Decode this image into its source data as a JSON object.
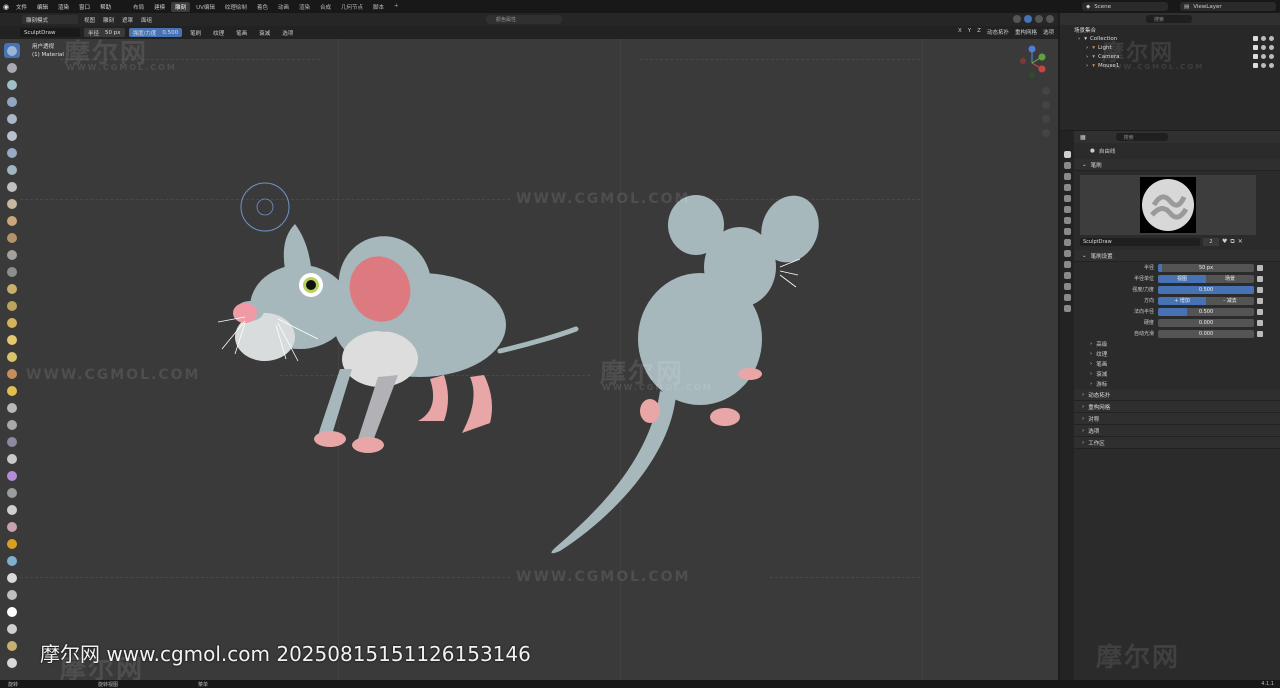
{
  "topbar": {
    "menus": [
      "文件",
      "编辑",
      "渲染",
      "窗口",
      "帮助"
    ],
    "workspaces": [
      {
        "label": "布局",
        "active": false
      },
      {
        "label": "建模",
        "active": false
      },
      {
        "label": "雕刻",
        "active": true
      },
      {
        "label": "UV编辑",
        "active": false
      },
      {
        "label": "纹理绘制",
        "active": false
      },
      {
        "label": "着色",
        "active": false
      },
      {
        "label": "动画",
        "active": false
      },
      {
        "label": "渲染",
        "active": false
      },
      {
        "label": "合成",
        "active": false
      },
      {
        "label": "几何节点",
        "active": false
      },
      {
        "label": "脚本",
        "active": false
      }
    ],
    "plus": "+",
    "scene": "Scene",
    "view_layer": "ViewLayer"
  },
  "viewport_header": {
    "mode": "雕刻模式",
    "menus": [
      "视图",
      "雕刻",
      "遮罩",
      "面组"
    ],
    "center_text": "颜色属性"
  },
  "tool_header": {
    "brush": "SculptDraw",
    "radius_label": "半径",
    "radius_value": "50 px",
    "strength_label": "强度/力度",
    "strength_value": "0.500",
    "dropdowns": [
      "笔刷",
      "纹理",
      "笔画",
      "衰减",
      "选项"
    ],
    "right_items": [
      "X",
      "Y",
      "Z",
      "动态拓扑",
      "重构网格",
      "选项"
    ]
  },
  "viewport": {
    "label_line1": "用户透视",
    "label_line2": "(1) Material",
    "accent": "#4772b3"
  },
  "watermarks": {
    "logo": "摩尔网",
    "url": "WWW.CGMOL.COM"
  },
  "stamp": "摩尔网 www.cgmol.com 20250815151126153146",
  "statusbar": {
    "items": [
      "旋转",
      "旋转视图",
      "菜单"
    ],
    "version": "4.1.1"
  },
  "outliner": {
    "title": "场景集合",
    "search_placeholder": "搜索",
    "rows": [
      {
        "label": "Collection"
      },
      {
        "label": "Light"
      },
      {
        "label": "Camera"
      },
      {
        "label": "Mouse1"
      }
    ]
  },
  "properties": {
    "search_placeholder": "搜索",
    "object_name": "自由线",
    "brush_section": "笔刷",
    "brush_name": "SculptDraw",
    "brush_users": "2",
    "settings_section": "笔刷设置",
    "rows": [
      {
        "label": "半径",
        "value": "50 px",
        "fill": 0.04
      },
      {
        "label": "半径单位",
        "options": [
          "视图",
          "场景"
        ],
        "active": 0
      },
      {
        "label": "强度/力度",
        "value": "0.500",
        "fill": 1.0
      },
      {
        "label": "方向",
        "options": [
          "+ 增加",
          "- 减去"
        ],
        "active": 0
      },
      {
        "label": "法向半径",
        "value": "0.500",
        "fill": 0.3
      },
      {
        "label": "硬度",
        "value": "0.000",
        "fill": 0
      },
      {
        "label": "自动光滑",
        "value": "0.000",
        "fill": 0
      }
    ],
    "subsections": [
      "高级",
      "纹理",
      "笔画",
      "衰减",
      "游标"
    ],
    "sections": [
      "动态拓扑",
      "重构网格",
      "对称",
      "选项",
      "工作区"
    ]
  }
}
